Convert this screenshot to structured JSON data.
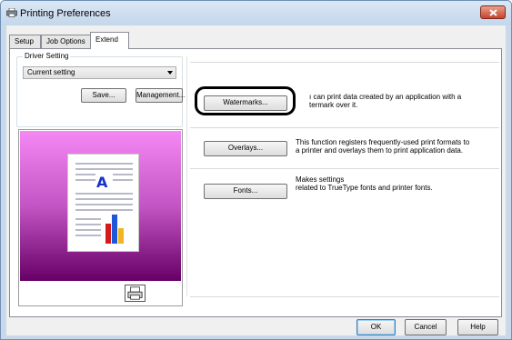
{
  "window": {
    "title": "Printing Preferences",
    "icons": {
      "title_icon": "printer-icon",
      "close_icon": "close-icon"
    },
    "accent_colors": {
      "close_button": "#c7432b",
      "title_bar": "#c3d6eb"
    }
  },
  "tabs": [
    {
      "label": "Setup",
      "active": false
    },
    {
      "label": "Job Options",
      "active": false
    },
    {
      "label": "Extend",
      "active": true
    }
  ],
  "driver_setting": {
    "group_label": "Driver Setting",
    "selected": "Current setting",
    "save_label": "Save...",
    "management_label": "Management..."
  },
  "preview": {
    "icon": "printer-small-icon",
    "background_colors": [
      "#f488f4",
      "#c455c4",
      "#660066"
    ],
    "letter": "A"
  },
  "features": [
    {
      "button": "Watermarks...",
      "description_line1": "ı can print data created by an application with a",
      "description_line2": "termark over it."
    },
    {
      "button": "Overlays...",
      "description_line1": "This function registers frequently-used print formats to",
      "description_line2": "a printer and overlays them to print application data."
    },
    {
      "button": "Fonts...",
      "description_line1": "Makes settings",
      "description_line2": "related to TrueType fonts and printer fonts."
    }
  ],
  "dialog_buttons": {
    "ok": "OK",
    "cancel": "Cancel",
    "help": "Help"
  }
}
